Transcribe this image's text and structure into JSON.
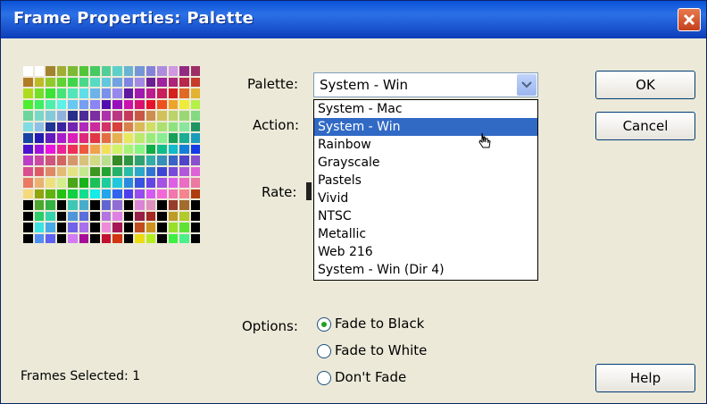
{
  "window": {
    "title": "Frame Properties: Palette"
  },
  "labels": {
    "palette": "Palette:",
    "action": "Action:",
    "rate": "Rate:",
    "options": "Options:",
    "frames_selected": "Frames Selected: 1"
  },
  "palette_select": {
    "value": "System - Win",
    "options": [
      "System - Mac",
      "System - Win",
      "Rainbow",
      "Grayscale",
      "Pastels",
      "Vivid",
      "NTSC",
      "Metallic",
      "Web 216",
      "System - Win (Dir 4)"
    ],
    "highlighted_index": 1
  },
  "buttons": {
    "ok": "OK",
    "cancel": "Cancel",
    "help": "Help"
  },
  "options": {
    "fade_black": "Fade to Black",
    "fade_white": "Fade to White",
    "dont_fade": "Don't Fade",
    "selected": "fade_black"
  },
  "colors": {
    "title_bar": "#2c71e6",
    "dialog_bg": "#ece9d8",
    "selection": "#316ac5",
    "radio_dot": "#21a121"
  }
}
